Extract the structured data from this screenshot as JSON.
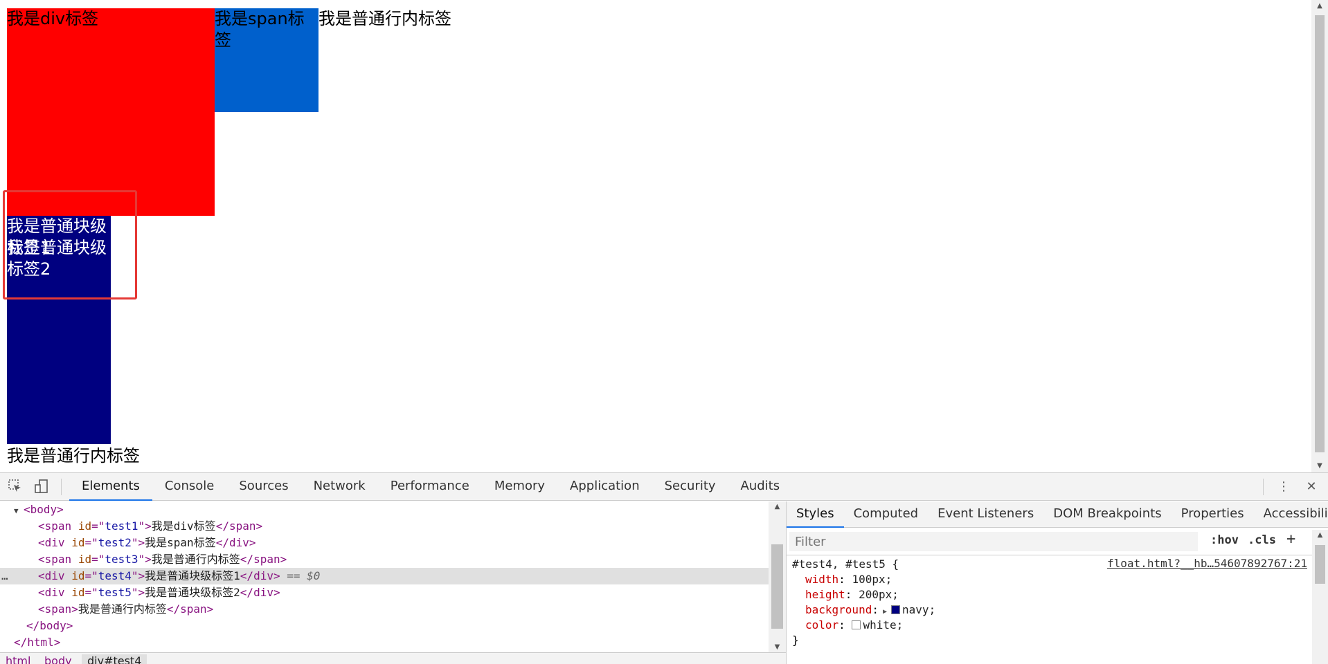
{
  "page": {
    "test1_text": "我是div标签",
    "test2_text": "我是span标签",
    "test3_text": "我是普通行内标签",
    "test4_text": "我是普通块级标签1",
    "test5_text": "我是普通块级标签2",
    "span_text": "我是普通行内标签",
    "colors": {
      "test1_bg": "#ff0000",
      "test2_bg": "#0060cc",
      "test4_bg": "#000080",
      "highlight": "#e53935"
    }
  },
  "devtools": {
    "tabs": [
      "Elements",
      "Console",
      "Sources",
      "Network",
      "Performance",
      "Memory",
      "Application",
      "Security",
      "Audits"
    ],
    "active_tab": "Elements",
    "dom": {
      "body_open": "<body>",
      "line1": {
        "tag": "span",
        "id_attr": "id",
        "id": "test1",
        "text": "我是div标签"
      },
      "line2": {
        "tag": "div",
        "id_attr": "id",
        "id": "test2",
        "text": "我是span标签"
      },
      "line3": {
        "tag": "span",
        "id_attr": "id",
        "id": "test3",
        "text": "我是普通行内标签"
      },
      "line4": {
        "tag": "div",
        "id_attr": "id",
        "id": "test4",
        "text": "我是普通块级标签1",
        "eq": "== $0"
      },
      "line5": {
        "tag": "div",
        "id_attr": "id",
        "id": "test5",
        "text": "我是普通块级标签2"
      },
      "line6": {
        "tag": "span",
        "text": "我是普通行内标签"
      },
      "body_close": "</body>",
      "html_close": "</html>"
    },
    "breadcrumb": [
      "html",
      "body",
      "div#test4"
    ],
    "styles_tabs": [
      "Styles",
      "Computed",
      "Event Listeners",
      "DOM Breakpoints",
      "Properties",
      "Accessibility"
    ],
    "filter_placeholder": "Filter",
    "hov": ":hov",
    "cls": ".cls",
    "plus": "+",
    "rule": {
      "selector": "#test4, #test5 {",
      "source": "float.html?__hb…54607892767:21",
      "props": [
        {
          "name": "width",
          "value": "100px;"
        },
        {
          "name": "height",
          "value": "200px;"
        },
        {
          "name": "background",
          "value": "navy;"
        },
        {
          "name": "color",
          "value": "white;"
        }
      ],
      "close": "}"
    }
  }
}
